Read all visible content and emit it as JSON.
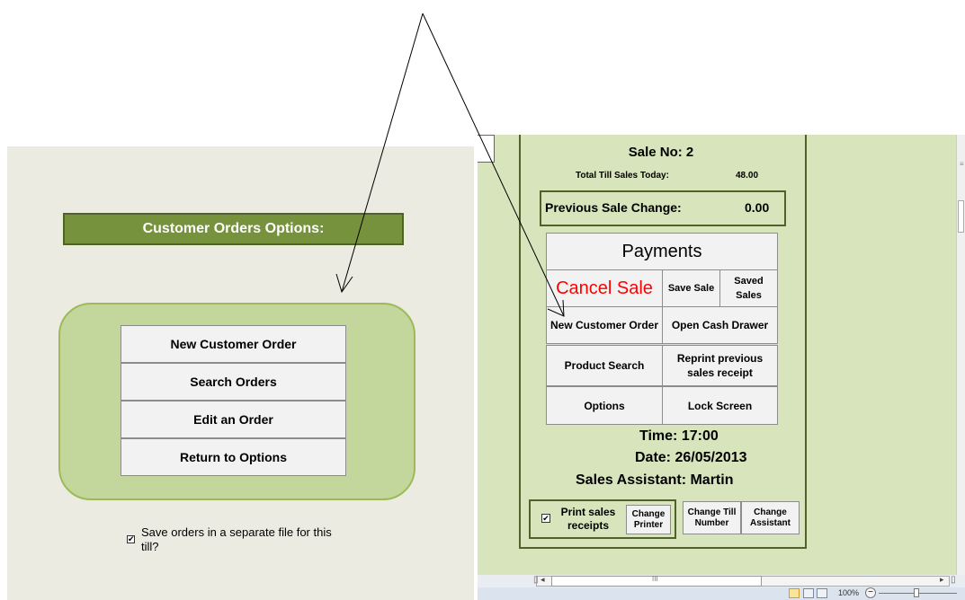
{
  "customer_orders": {
    "title": "Customer Orders Options:",
    "buttons": [
      "New Customer Order",
      "Search Orders",
      "Edit an Order",
      "Return to Options"
    ],
    "save_checkbox": {
      "checked": true,
      "label": "Save orders in a separate file for this till?"
    }
  },
  "till": {
    "sale_no": "Sale No: 2",
    "total_sales_label": "Total Till Sales Today:",
    "total_sales_value": "48.00",
    "prev_change_label": "Previous Sale Change:",
    "prev_change_value": "0.00",
    "payments_label": "Payments",
    "cancel_sale_label": "Cancel Sale",
    "save_sale_label": "Save Sale",
    "saved_sales_label": "Saved Sales",
    "new_customer_order_label": "New Customer Order",
    "open_cash_drawer_label": "Open Cash Drawer",
    "product_search_label": "Product Search",
    "reprint_label": "Reprint previous sales receipt",
    "options_label": "Options",
    "lock_screen_label": "Lock Screen",
    "time_text": "Time: 17:00",
    "date_text": "Date: 26/05/2013",
    "assistant_text": "Sales Assistant: Martin",
    "print_receipts_label": "Print sales receipts",
    "print_receipts_checked": true,
    "change_printer_label": "Change Printer",
    "change_till_label": "Change Till Number",
    "change_assistant_label": "Change Assistant"
  },
  "status_bar": {
    "zoom": "100%",
    "zoom_minus": "−"
  },
  "colors": {
    "title_bar": "#76923c",
    "options_box": "#c3d69b",
    "till_background": "#d8e4bc",
    "cancel_text": "#ff0000"
  }
}
